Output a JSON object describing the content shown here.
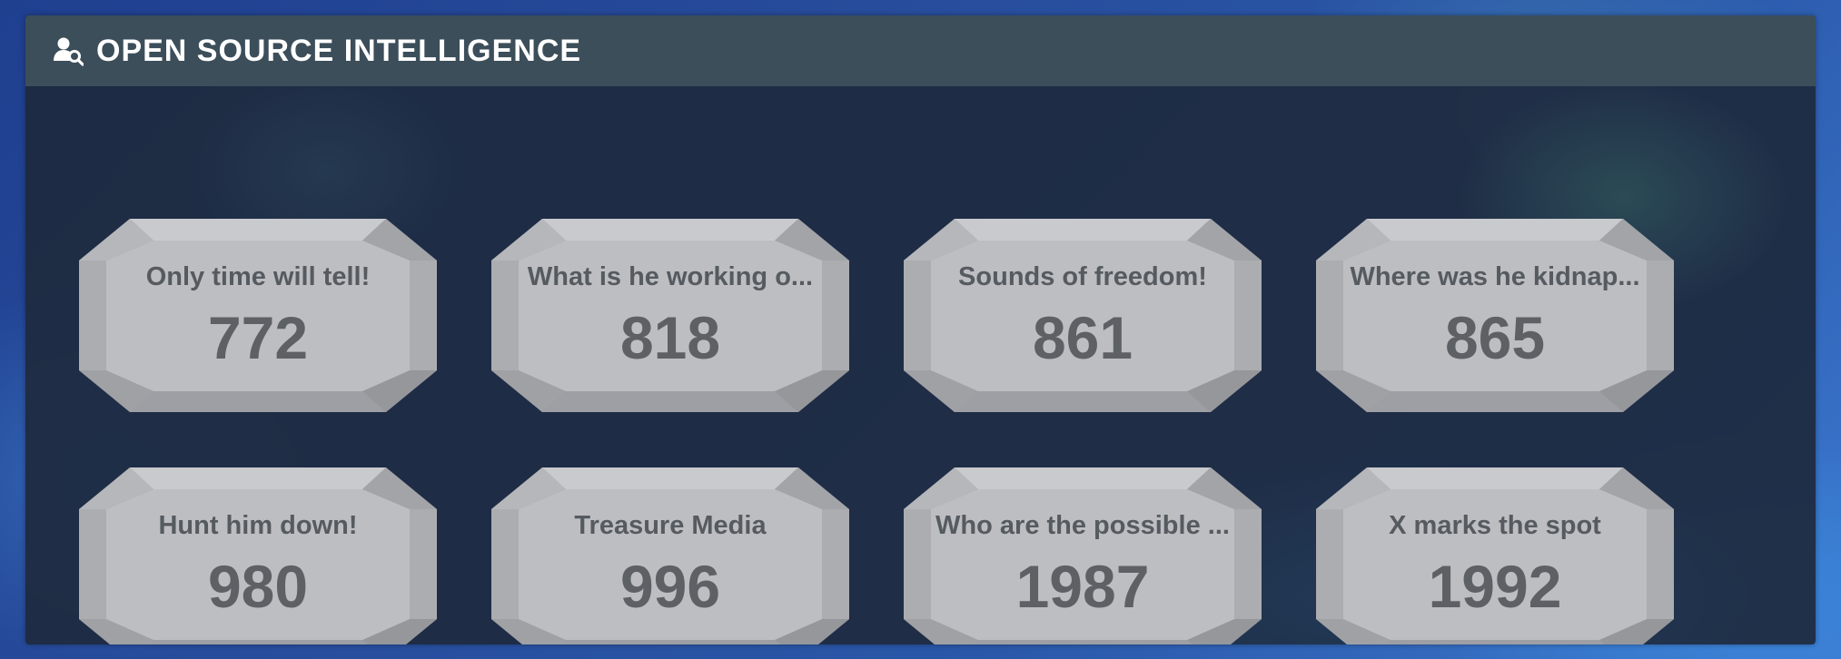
{
  "header": {
    "title": "OPEN SOURCE INTELLIGENCE",
    "icon": "user-search-icon"
  },
  "colors": {
    "panel_header": "#3c4e5a",
    "panel_body": "#1e2a3e",
    "card_face": "#bdbec2",
    "card_text": "#5d6064"
  },
  "cards": [
    {
      "label": "Only time will tell!",
      "value": "772"
    },
    {
      "label": "What is he working o...",
      "value": "818"
    },
    {
      "label": "Sounds of freedom!",
      "value": "861"
    },
    {
      "label": "Where was he kidnap...",
      "value": "865"
    },
    {
      "label": "Hunt him down!",
      "value": "980"
    },
    {
      "label": "Treasure Media",
      "value": "996"
    },
    {
      "label": "Who are the possible ...",
      "value": "1987"
    },
    {
      "label": "X marks the spot",
      "value": "1992"
    }
  ]
}
